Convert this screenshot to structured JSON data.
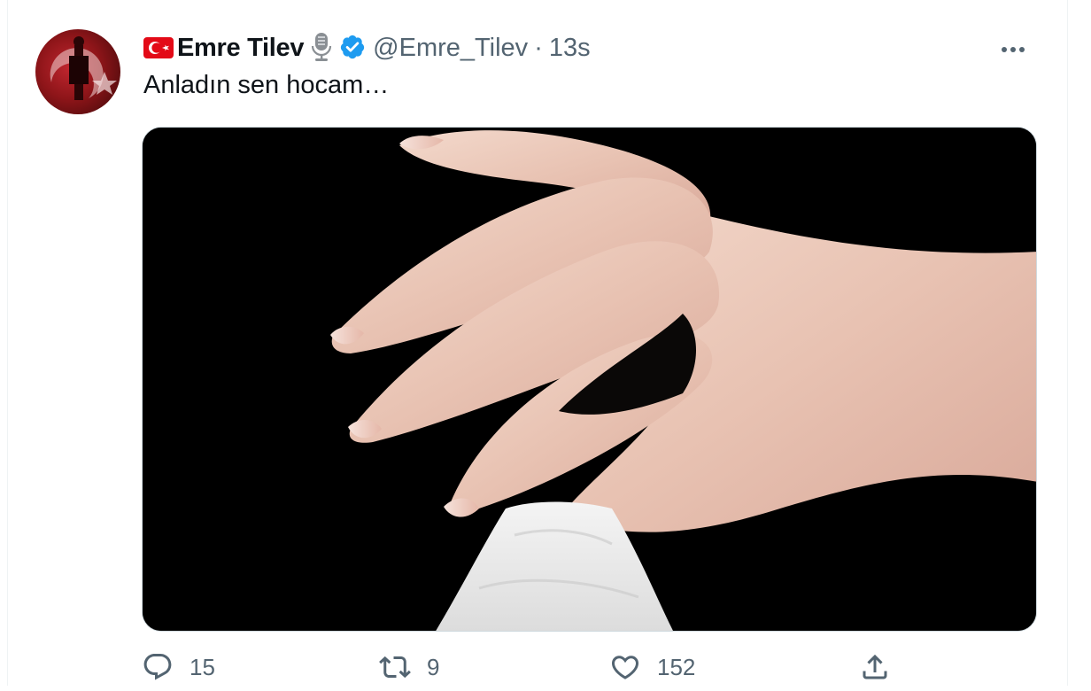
{
  "author": {
    "flag_icon": "turkey-flag-icon",
    "display_name": "Emre Tilev",
    "badges": [
      "microphone-icon",
      "verified-badge-icon"
    ],
    "handle": "@Emre_Tilev",
    "separator": "·",
    "timestamp": "13s"
  },
  "tweet": {
    "text": "Anladın sen hocam…"
  },
  "menu": {
    "more_icon": "more-options-icon"
  },
  "actions": {
    "reply": {
      "icon": "reply-icon",
      "count": "15"
    },
    "retweet": {
      "icon": "retweet-icon",
      "count": "9"
    },
    "like": {
      "icon": "like-icon",
      "count": "152"
    },
    "share": {
      "icon": "share-icon"
    }
  },
  "colors": {
    "text": "#0f1419",
    "secondary": "#536471",
    "verified": "#1d9bf0",
    "flag_red": "#e30a17",
    "border": "#cfd9de"
  }
}
